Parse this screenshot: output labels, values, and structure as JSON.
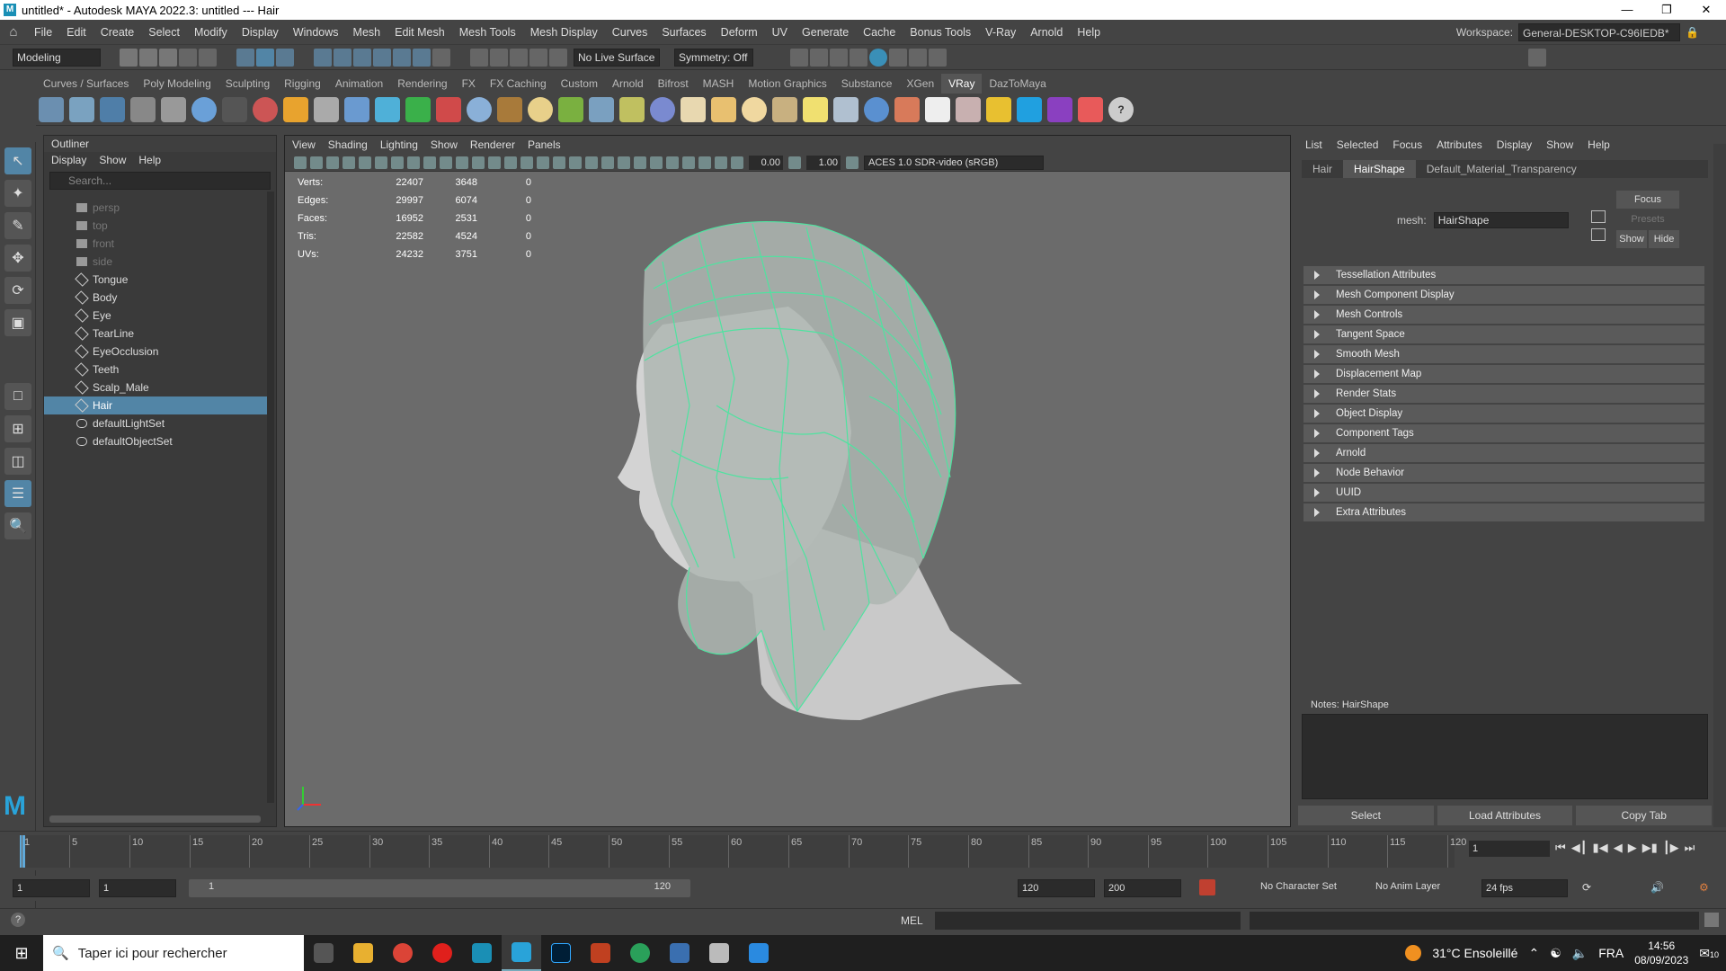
{
  "titlebar": {
    "title": "untitled* - Autodesk MAYA 2022.3: untitled   ---   Hair",
    "logo": "M"
  },
  "menubar": {
    "items": [
      "File",
      "Edit",
      "Create",
      "Select",
      "Modify",
      "Display",
      "Windows",
      "Mesh",
      "Edit Mesh",
      "Mesh Tools",
      "Mesh Display",
      "Curves",
      "Surfaces",
      "Deform",
      "UV",
      "Generate",
      "Cache",
      "Bonus Tools",
      "V-Ray",
      "Arnold",
      "Help"
    ],
    "workspace_label": "Workspace:",
    "workspace_value": "General-DESKTOP-C96IEDB*"
  },
  "statusline": {
    "mode": "Modeling",
    "live_surface": "No Live Surface",
    "symmetry": "Symmetry: Off"
  },
  "shelf": {
    "tabs": [
      "Curves / Surfaces",
      "Poly Modeling",
      "Sculpting",
      "Rigging",
      "Animation",
      "Rendering",
      "FX",
      "FX Caching",
      "Custom",
      "Arnold",
      "Bifrost",
      "MASH",
      "Motion Graphics",
      "Substance",
      "XGen",
      "VRay",
      "DazToMaya"
    ],
    "active_tab": "VRay"
  },
  "outliner": {
    "title": "Outliner",
    "menu": [
      "Display",
      "Show",
      "Help"
    ],
    "search_placeholder": "Search...",
    "items": [
      {
        "label": "persp",
        "kind": "camera",
        "dim": true
      },
      {
        "label": "top",
        "kind": "camera",
        "dim": true
      },
      {
        "label": "front",
        "kind": "camera",
        "dim": true
      },
      {
        "label": "side",
        "kind": "camera",
        "dim": true
      },
      {
        "label": "Tongue",
        "kind": "mesh",
        "dim": false
      },
      {
        "label": "Body",
        "kind": "mesh",
        "dim": false
      },
      {
        "label": "Eye",
        "kind": "mesh",
        "dim": false
      },
      {
        "label": "TearLine",
        "kind": "mesh",
        "dim": false
      },
      {
        "label": "EyeOcclusion",
        "kind": "mesh",
        "dim": false
      },
      {
        "label": "Teeth",
        "kind": "mesh",
        "dim": false
      },
      {
        "label": "Scalp_Male",
        "kind": "mesh",
        "dim": false
      },
      {
        "label": "Hair",
        "kind": "mesh",
        "dim": false,
        "selected": true
      },
      {
        "label": "defaultLightSet",
        "kind": "set",
        "dim": false
      },
      {
        "label": "defaultObjectSet",
        "kind": "set",
        "dim": false
      }
    ]
  },
  "viewport": {
    "menu": [
      "View",
      "Shading",
      "Lighting",
      "Show",
      "Renderer",
      "Panels"
    ],
    "exposure": "0.00",
    "gamma": "1.00",
    "color_space": "ACES 1.0 SDR-video (sRGB)",
    "hud": [
      {
        "label": "Verts:",
        "a": "22407",
        "b": "3648",
        "c": "0"
      },
      {
        "label": "Edges:",
        "a": "29997",
        "b": "6074",
        "c": "0"
      },
      {
        "label": "Faces:",
        "a": "16952",
        "b": "2531",
        "c": "0"
      },
      {
        "label": "Tris:",
        "a": "22582",
        "b": "4524",
        "c": "0"
      },
      {
        "label": "UVs:",
        "a": "24232",
        "b": "3751",
        "c": "0"
      }
    ],
    "wire_color": "#4fe3a0"
  },
  "attr": {
    "menu": [
      "List",
      "Selected",
      "Focus",
      "Attributes",
      "Display",
      "Show",
      "Help"
    ],
    "tabs": [
      "Hair",
      "HairShape",
      "Default_Material_Transparency"
    ],
    "active_tab": "HairShape",
    "mesh_label": "mesh:",
    "mesh_value": "HairShape",
    "focus": "Focus",
    "presets": "Presets",
    "show": "Show",
    "hide": "Hide",
    "sections": [
      "Tessellation Attributes",
      "Mesh Component Display",
      "Mesh Controls",
      "Tangent Space",
      "Smooth Mesh",
      "Displacement Map",
      "Render Stats",
      "Object Display",
      "Component Tags",
      "Arnold",
      "Node Behavior",
      "UUID",
      "Extra Attributes"
    ],
    "notes_label": "Notes: HairShape",
    "buttons": [
      "Select",
      "Load Attributes",
      "Copy Tab"
    ]
  },
  "timeline": {
    "ticks": [
      1,
      5,
      10,
      15,
      20,
      25,
      30,
      35,
      40,
      45,
      50,
      55,
      60,
      65,
      70,
      75,
      80,
      85,
      90,
      95,
      100,
      105,
      110,
      115,
      120
    ],
    "current_frame": "1"
  },
  "range": {
    "start": "1",
    "playback_start": "1",
    "range_start": "1",
    "range_end": "120",
    "playback_end": "120",
    "end": "200",
    "character_set": "No Character Set",
    "anim_layer": "No Anim Layer",
    "fps": "24 fps"
  },
  "cmdline": {
    "lang": "MEL"
  },
  "taskbar": {
    "search_placeholder": "Taper ici pour rechercher",
    "weather": "31°C  Ensoleillé",
    "lang": "FRA",
    "time": "14:56",
    "date": "08/09/2023",
    "notif": "10"
  }
}
